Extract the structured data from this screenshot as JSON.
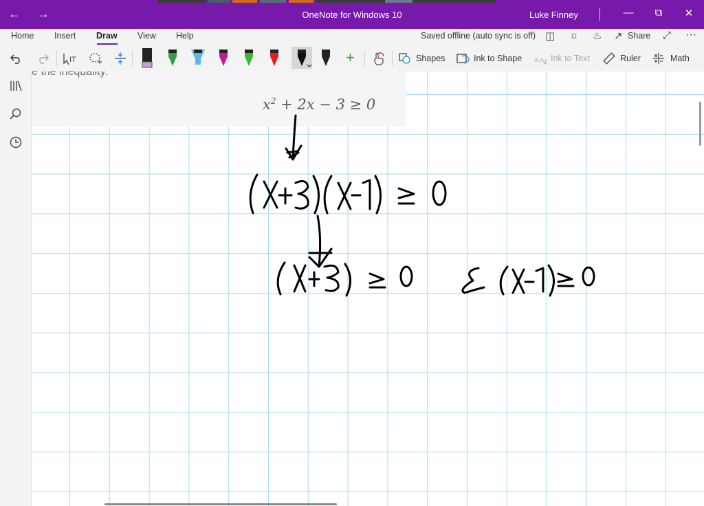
{
  "window": {
    "title": "OneNote for Windows 10",
    "user": "Luke Finney",
    "back_icon": "arrow-left-icon",
    "forward_icon": "arrow-right-icon",
    "accent": "#7719aa"
  },
  "menu": {
    "tabs": [
      "Home",
      "Insert",
      "Draw",
      "View",
      "Help"
    ],
    "active_tab": "Draw",
    "status": "Saved offline (auto sync is off)",
    "share_label": "Share",
    "more_label": "···"
  },
  "toolbar": {
    "shapes_label": "Shapes",
    "ink_to_shape_label": "Ink to Shape",
    "ink_to_text_label": "Ink to Text",
    "ruler_label": "Ruler",
    "math_label": "Math",
    "add_pen_label": "+",
    "pens": [
      {
        "name": "pen-black-purple",
        "color": "#222222",
        "accent": "#c9a0dc"
      },
      {
        "name": "pen-green",
        "color": "#2ea043",
        "accent": "#222222"
      },
      {
        "name": "highlighter-light-blue",
        "color": "#5db8e8",
        "accent": "#222222"
      },
      {
        "name": "pen-magenta",
        "color": "#c2189b",
        "accent": "#222222"
      },
      {
        "name": "pen-lime",
        "color": "#35b82d",
        "accent": "#222222"
      },
      {
        "name": "pen-red",
        "color": "#e01e1e",
        "accent": "#222222"
      },
      {
        "name": "pen-black-selected",
        "color": "#111111",
        "accent": "#111111"
      },
      {
        "name": "pen-black-dotted",
        "color": "#222222",
        "accent": "#222222"
      }
    ]
  },
  "problem": {
    "text_fragment": "e the inequality.",
    "expression": "x² + 2x − 3 ≥ 0"
  },
  "ink": {
    "line1": "(x+3)(x-1) ≥ 0",
    "line2": "(x+3) ≥ 0 & (x-1) ≥ 0"
  }
}
